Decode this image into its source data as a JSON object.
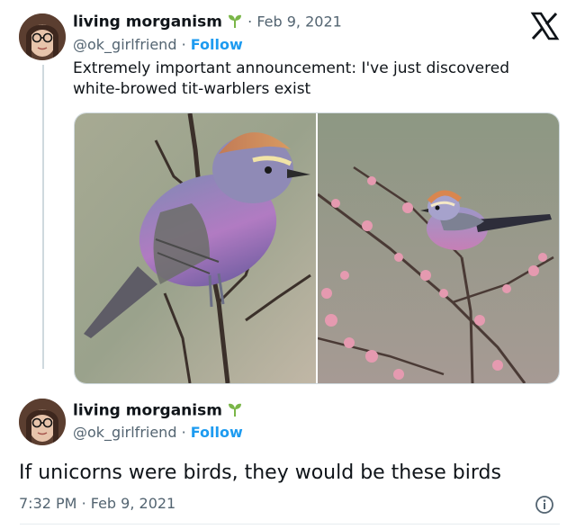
{
  "reply_tweet": {
    "display_name": "living morganism",
    "handle": "@ok_girlfriend",
    "follow_label": "Follow",
    "separator": "·",
    "date": "Feb 9, 2021",
    "text_line1": "Extremely important announcement: I've just discovered",
    "text_line2": "white-browed tit-warblers exist"
  },
  "main_tweet": {
    "display_name": "living morganism",
    "handle": "@ok_girlfriend",
    "follow_label": "Follow",
    "separator": "·",
    "text": "If unicorns were birds, they would be these birds",
    "time": "7:32 PM",
    "date": "Feb 9, 2021"
  },
  "brand": {
    "logo_char": "X"
  },
  "icons": {
    "verified_sprout": "sprout-icon",
    "info": "info-icon",
    "logo": "x-logo-icon"
  },
  "colors": {
    "accent": "#1d9bf0",
    "secondary_text": "#536471",
    "sprout_green": "#7ab648"
  }
}
